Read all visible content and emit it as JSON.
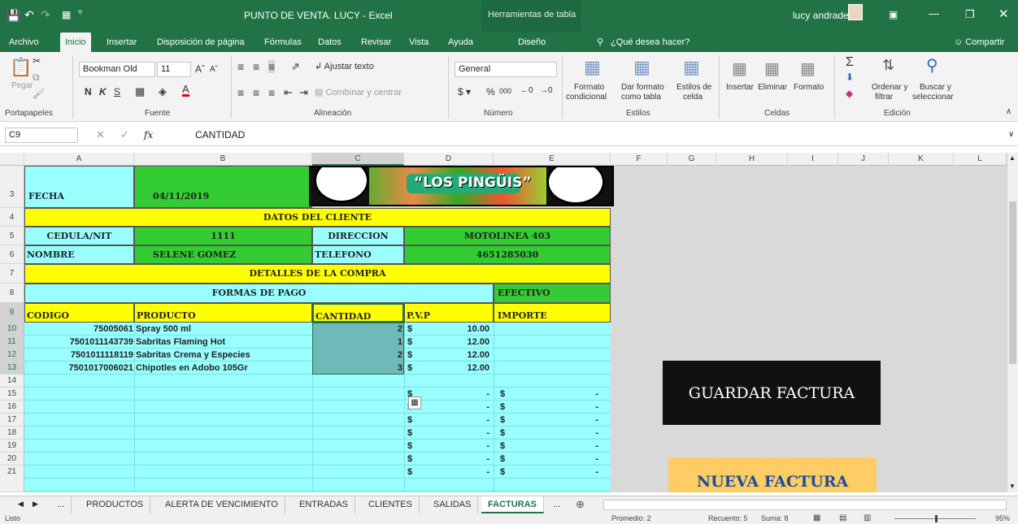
{
  "title_bar": {
    "title": "PUNTO DE VENTA. LUCY - Excel",
    "context_tab": "Herramientas de tabla",
    "user": "lucy andrade"
  },
  "ribbon_tabs": [
    "Archivo",
    "Inicio",
    "Insertar",
    "Disposición de página",
    "Fórmulas",
    "Datos",
    "Revisar",
    "Vista",
    "Ayuda",
    "Diseño"
  ],
  "tell_me": "¿Qué desea hacer?",
  "share": "Compartir",
  "ribbon": {
    "paste": "Pegar",
    "clipboard": "Portapapeles",
    "font_name": "Bookman Old",
    "font_size": "11",
    "font_group": "Fuente",
    "wrap_text": "Ajustar texto",
    "merge_center": "Combinar y centrar",
    "alignment": "Alineación",
    "number_format": "General",
    "number_group": "Número",
    "conditional_format": "Formato",
    "conditional_format_2": "condicional",
    "format_table": "Dar formato",
    "format_table_2": "como tabla",
    "cell_styles": "Estilos de",
    "cell_styles_2": "celda",
    "styles_group": "Estilos",
    "insert": "Insertar",
    "delete": "Eliminar",
    "format": "Formato",
    "cells_group": "Celdas",
    "sort": "Ordenar y",
    "sort_2": "filtrar",
    "find": "Buscar y",
    "find_2": "seleccionar",
    "editing_group": "Edición",
    "bold": "N",
    "italic": "K",
    "underline": "S"
  },
  "formula_bar": {
    "name_box": "C9",
    "fx": "fx",
    "content": "CANTIDAD"
  },
  "columns": [
    "A",
    "B",
    "C",
    "D",
    "E",
    "F",
    "G",
    "H",
    "I",
    "J",
    "K",
    "L"
  ],
  "rows": [
    "3",
    "4",
    "5",
    "6",
    "7",
    "8",
    "9",
    "10",
    "11",
    "12",
    "13",
    "14",
    "15",
    "16",
    "17",
    "18",
    "19",
    "20",
    "21"
  ],
  "invoice": {
    "fecha_label": "FECHA",
    "fecha_value": "04/11/2019",
    "logo_text": "“LOS PINGÜIS”",
    "datos_cliente": "DATOS DEL CLIENTE",
    "cedula_label": "CEDULA/NIT",
    "cedula_value": "1111",
    "direccion_label": "DIRECCION",
    "direccion_value": "MOTOLINEA 403",
    "nombre_label": "NOMBRE",
    "nombre_value": "SELENE GOMEZ",
    "telefono_label": "TELEFONO",
    "telefono_value": "4651285030",
    "detalles": "DETALLES DE LA COMPRA",
    "formas_pago": "FORMAS DE PAGO",
    "efectivo": "EFECTIVO",
    "h_codigo": "CODIGO",
    "h_producto": "PRODUCTO",
    "h_cantidad": "CANTIDAD",
    "h_pvp": "P.V.P",
    "h_importe": "IMPORTE",
    "items": [
      {
        "codigo": "75005061",
        "producto": "Spray 500 ml",
        "cantidad": "2",
        "cur": "$",
        "pvp": "10.00"
      },
      {
        "codigo": "7501011143739",
        "producto": "Sabritas Flaming Hot",
        "cantidad": "1",
        "cur": "$",
        "pvp": "12.00"
      },
      {
        "codigo": "7501011118119",
        "producto": "Sabritas Crema y Especies",
        "cantidad": "2",
        "cur": "$",
        "pvp": "12.00"
      },
      {
        "codigo": "7501017006021",
        "producto": "Chipotles en Adobo 105Gr",
        "cantidad": "3",
        "cur": "$",
        "pvp": "12.00"
      }
    ],
    "empty": {
      "cur": "$",
      "dash": "-"
    }
  },
  "buttons": {
    "guardar": "GUARDAR FACTURA",
    "nueva": "NUEVA FACTURA"
  },
  "sheet_tabs": [
    "...",
    "PRODUCTOS",
    "ALERTA DE VENCIMIENTO",
    "ENTRADAS",
    "CLIENTES",
    "SALIDAS",
    "FACTURAS",
    "..."
  ],
  "status": {
    "ready": "Listo",
    "average": "Promedio: 2",
    "count": "Recuento: 5",
    "sum": "Suma: 8",
    "zoom": "95%"
  },
  "colors": {
    "excel_green": "#217346",
    "cell_green": "#33cc33",
    "cell_cyan": "#99ffff",
    "cell_yellow": "#ffff00",
    "save_button": "#111111",
    "new_button": "#ffcc66",
    "new_text": "#1f4e99"
  }
}
